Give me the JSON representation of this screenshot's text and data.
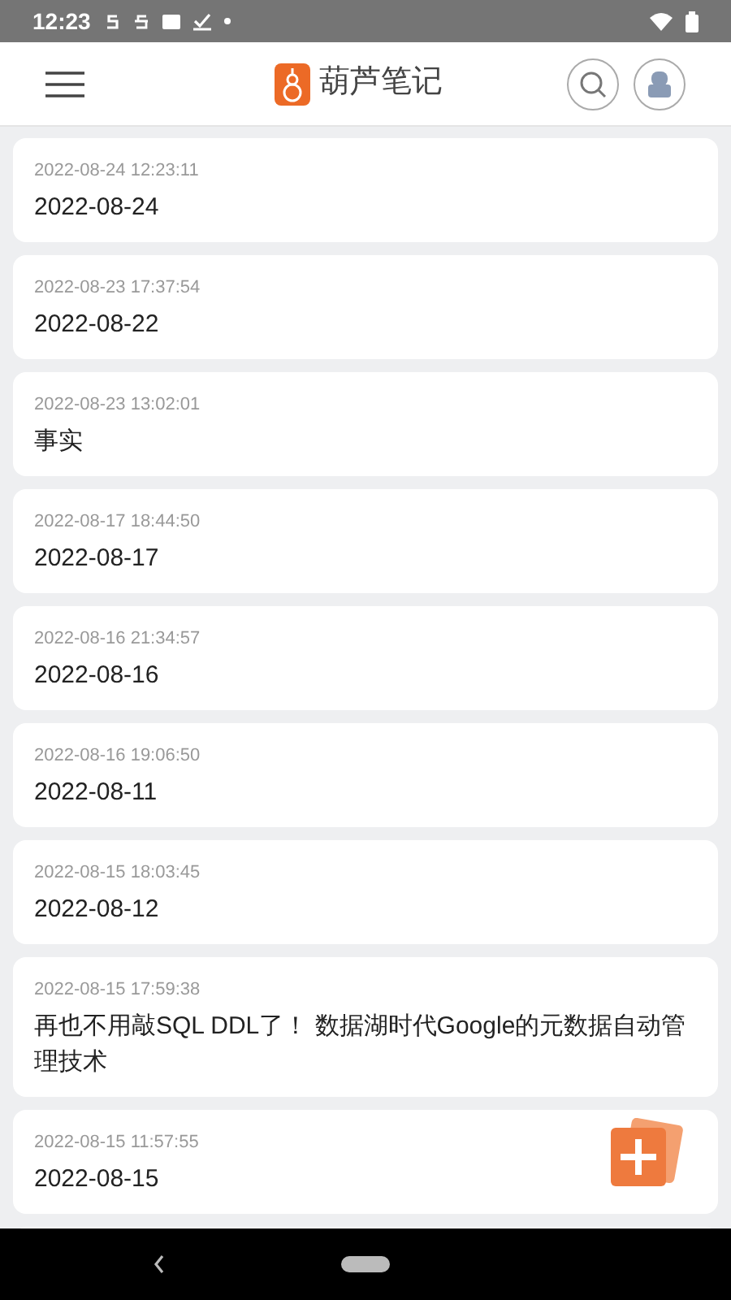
{
  "status_bar": {
    "time": "12:23"
  },
  "header": {
    "title": "葫芦笔记"
  },
  "notes": [
    {
      "timestamp": "2022-08-24 12:23:11",
      "title": "2022-08-24"
    },
    {
      "timestamp": "2022-08-23 17:37:54",
      "title": "2022-08-22"
    },
    {
      "timestamp": "2022-08-23 13:02:01",
      "title": "事实"
    },
    {
      "timestamp": "2022-08-17 18:44:50",
      "title": "2022-08-17"
    },
    {
      "timestamp": "2022-08-16 21:34:57",
      "title": "2022-08-16"
    },
    {
      "timestamp": "2022-08-16 19:06:50",
      "title": "2022-08-11"
    },
    {
      "timestamp": "2022-08-15 18:03:45",
      "title": "2022-08-12"
    },
    {
      "timestamp": "2022-08-15 17:59:38",
      "title": "再也不用敲SQL DDL了！ 数据湖时代Google的元数据自动管理技术"
    },
    {
      "timestamp": "2022-08-15 11:57:55",
      "title": "2022-08-15"
    }
  ]
}
